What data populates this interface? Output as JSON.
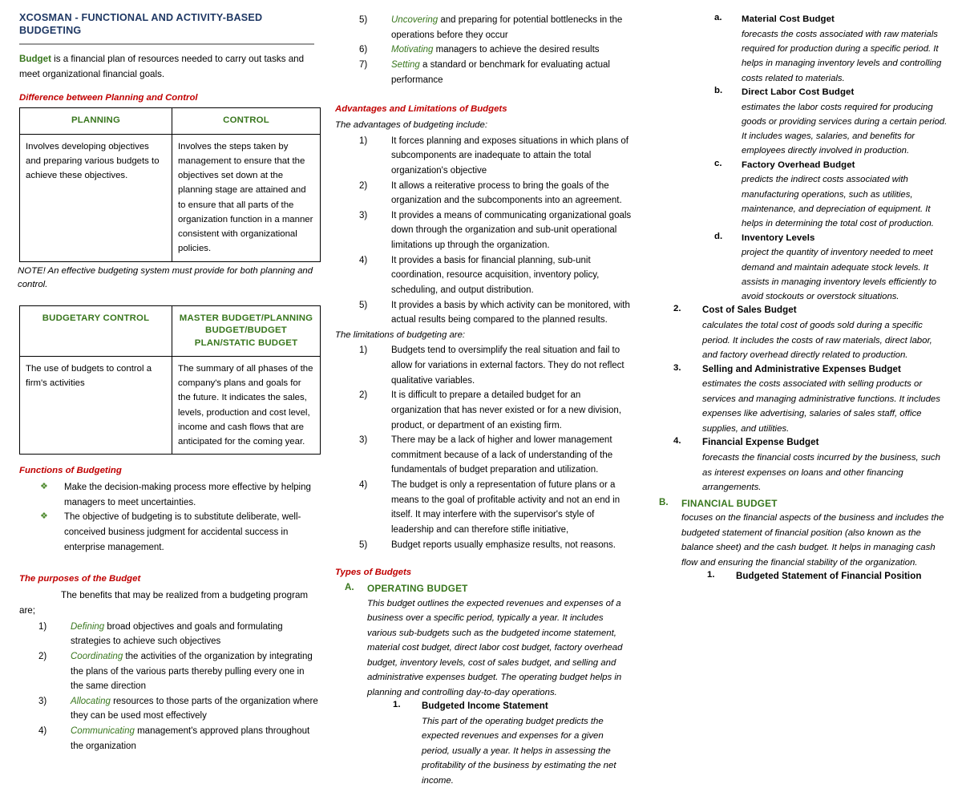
{
  "colors": {
    "title_blue": "#1F3864",
    "heading_red": "#C00000",
    "accent_green": "#38761D",
    "bullet_green": "#4E8A2E"
  },
  "document": {
    "title": "XCOSMAN - FUNCTIONAL AND ACTIVITY-BASED BUDGETING",
    "lead_keyword": "Budget",
    "lead_text": " is a financial plan of resources needed to carry out tasks and meet organizational financial goals."
  },
  "section_planning_control": {
    "heading": "Difference between Planning and Control",
    "headers": [
      "PLANNING",
      "CONTROL"
    ],
    "cells": [
      "Involves developing objectives and preparing various budgets to achieve these objectives.",
      "Involves the steps taken by management to ensure that the objectives set down at the planning stage are attained and to ensure that all parts of the organization function in a manner consistent with organizational policies."
    ],
    "note": "NOTE! An effective budgeting system must provide for both planning and control."
  },
  "section_budgetary_control": {
    "headers": [
      "BUDGETARY CONTROL",
      "MASTER BUDGET/PLANNING BUDGET/BUDGET PLAN/STATIC BUDGET"
    ],
    "cells": [
      "The use of budgets to control a firm's activities",
      "The summary of all phases of the company's plans and goals for the future. It indicates the sales, levels, production and cost level, income and cash flows that are anticipated for the coming year."
    ]
  },
  "section_functions": {
    "heading": "Functions of Budgeting",
    "bullet_glyph": "❖",
    "items": [
      "Make the decision-making process more effective by helping managers to meet uncertainties.",
      "The objective of budgeting is to substitute deliberate, well-conceived business judgment for accidental success in enterprise management."
    ]
  },
  "section_purposes": {
    "heading": "The purposes of the Budget",
    "intro": "The benefits that may be realized from a budgeting program are;",
    "items": [
      {
        "marker": "1)",
        "lead": "Defining",
        "text": " broad objectives and goals and formulating strategies to achieve such objectives"
      },
      {
        "marker": "2)",
        "lead": "Coordinating",
        "text": " the activities of the organization by integrating the plans of the various parts thereby pulling every one in the same direction"
      },
      {
        "marker": "3)",
        "lead": "Allocating",
        "text": " resources to those parts of the organization where they can be used most effectively"
      },
      {
        "marker": "4)",
        "lead": "Communicating",
        "text": " management's approved plans throughout the organization"
      },
      {
        "marker": "5)",
        "lead": "Uncovering",
        "text": " and preparing for potential bottlenecks in the operations before they occur"
      },
      {
        "marker": "6)",
        "lead": "Motivating",
        "text": " managers to achieve the desired results"
      },
      {
        "marker": "7)",
        "lead": "Setting",
        "text": " a standard or benchmark for evaluating actual performance"
      }
    ]
  },
  "section_adv_lim": {
    "heading": "Advantages and Limitations of Budgets",
    "advantages_intro": "The advantages of budgeting include:",
    "advantages": [
      {
        "marker": "1)",
        "text": "It forces planning and exposes situations in which plans of subcomponents are inadequate to attain the total organization's objective"
      },
      {
        "marker": "2)",
        "text": "It allows a reiterative process to bring the goals of the organization and the subcomponents into an agreement."
      },
      {
        "marker": "3)",
        "text": "It provides a means of communicating organizational goals down through the organization and sub-unit operational limitations up through the organization."
      },
      {
        "marker": "4)",
        "text": "It provides a basis for financial planning, sub-unit coordination, resource acquisition, inventory policy, scheduling, and output distribution."
      },
      {
        "marker": "5)",
        "text": "It provides a basis by which activity can be monitored, with actual results being compared to the planned results."
      }
    ],
    "limitations_intro": "The limitations of budgeting are:",
    "limitations": [
      {
        "marker": "1)",
        "text": "Budgets tend to oversimplify the real situation and fail to allow for variations in external factors. They do not reflect qualitative variables."
      },
      {
        "marker": "2)",
        "text": "It is difficult to prepare a detailed budget for an organization that has never existed or for a new division, product, or department of an existing firm."
      },
      {
        "marker": "3)",
        "text": "There may be a lack of higher and lower management commitment because of a lack of understanding of the fundamentals of budget preparation and utilization."
      },
      {
        "marker": "4)",
        "text": "The budget is only a representation of future plans or a means to the goal of profitable activity and not an end in itself. It may interfere with the supervisor's style of leadership and can therefore stifle initiative,"
      },
      {
        "marker": "5)",
        "text": "Budget reports usually emphasize results, not reasons."
      }
    ]
  },
  "section_types": {
    "heading": "Types of Budgets",
    "operating": {
      "marker": "A.",
      "title": "OPERATING BUDGET",
      "body": "This budget outlines the expected revenues and expenses of a business over a specific period, typically a year. It includes various sub-budgets such as the budgeted income statement, material cost budget, direct labor cost budget, factory overhead budget, inventory levels, cost of sales budget, and selling and administrative expenses budget. The operating budget helps in planning and controlling day-to-day operations.",
      "items": [
        {
          "marker": "1.",
          "title": "Budgeted Income Statement",
          "body": "This part of the operating budget predicts the expected revenues and expenses for a given period, usually a year. It helps in assessing the profitability of the business by estimating the net income.",
          "subitems": [
            {
              "marker": "a.",
              "title": "Material Cost Budget",
              "body": "forecasts the costs associated with raw materials required for production during a specific period. It helps in managing inventory levels and controlling costs related to materials."
            },
            {
              "marker": "b.",
              "title": "Direct Labor Cost Budget",
              "body": "estimates the labor costs required for producing goods or providing services during a certain period. It includes wages, salaries, and benefits for employees directly involved in production."
            },
            {
              "marker": "c.",
              "title": "Factory Overhead Budget",
              "body": "predicts the indirect costs associated with manufacturing operations, such as utilities, maintenance, and depreciation of equipment. It helps in determining the total cost of production."
            },
            {
              "marker": "d.",
              "title": "Inventory Levels",
              "body": "project the quantity of inventory needed to meet demand and maintain adequate stock levels. It assists in managing inventory levels efficiently to avoid stockouts or overstock situations."
            }
          ]
        },
        {
          "marker": "2.",
          "title": "Cost of Sales Budget",
          "body": "calculates the total cost of goods sold during a specific period. It includes the costs of raw materials, direct labor, and factory overhead directly related to production."
        },
        {
          "marker": "3.",
          "title": "Selling and Administrative Expenses Budget",
          "body": "estimates the costs associated with selling products or services and managing administrative functions. It includes expenses like advertising, salaries of sales staff, office supplies, and utilities."
        },
        {
          "marker": "4.",
          "title": "Financial Expense Budget",
          "body": " forecasts the financial costs incurred by the business, such as interest expenses on loans and other financing arrangements."
        }
      ]
    },
    "financial": {
      "marker": "B.",
      "title": "FINANCIAL BUDGET",
      "body": "focuses on the financial aspects of the business and includes the budgeted statement of financial position (also known as the balance sheet) and the cash budget. It helps in managing cash flow and ensuring the financial stability of the organization.",
      "items": [
        {
          "marker": "1.",
          "title": "Budgeted Statement of Financial Position",
          "body": ""
        }
      ]
    }
  }
}
